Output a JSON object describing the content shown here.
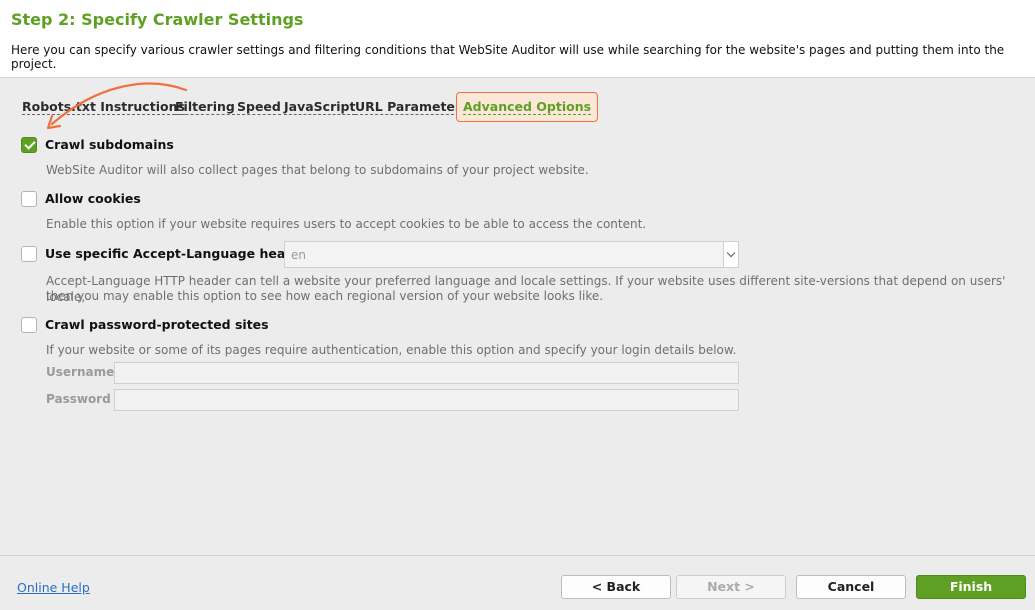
{
  "header": {
    "title": "Step 2: Specify Crawler Settings",
    "description": "Here you can specify various crawler settings and filtering conditions that WebSite Auditor will use while searching for the website's pages and putting them into the project."
  },
  "tabs": [
    {
      "label": "Robots.txt Instructions",
      "active": false
    },
    {
      "label": "Filtering",
      "active": false
    },
    {
      "label": "Speed",
      "active": false
    },
    {
      "label": "JavaScript",
      "active": false
    },
    {
      "label": "URL Parameters",
      "active": false
    },
    {
      "label": "Advanced Options",
      "active": true
    }
  ],
  "options": {
    "crawl_subdomains": {
      "label": "Crawl subdomains",
      "checked": true,
      "description": "WebSite Auditor will also collect pages that belong to subdomains of your project website."
    },
    "allow_cookies": {
      "label": "Allow cookies",
      "checked": false,
      "description": "Enable this option if your website requires users to accept cookies to be able to access the content."
    },
    "accept_language": {
      "label": "Use specific Accept-Language header",
      "checked": false,
      "value": "en",
      "description_line1": "Accept-Language HTTP header can tell a website your preferred language and locale settings. If your website uses different site-versions that depend on users' locale,",
      "description_line2": "then you may enable this option to see how each regional version of your website looks like."
    },
    "password_protected": {
      "label": "Crawl password-protected sites",
      "checked": false,
      "description": "If your website or some of its pages require authentication, enable this option and specify your login details below.",
      "username_label": "Username",
      "username_value": "",
      "password_label": "Password",
      "password_value": ""
    }
  },
  "footer": {
    "help_link": "Online Help",
    "back_label": "< Back",
    "next_label": "Next >",
    "cancel_label": "Cancel",
    "finish_label": "Finish"
  },
  "colors": {
    "accent_green": "#5fa024",
    "highlight_orange": "#f07040",
    "link_blue": "#2a6fc2"
  }
}
